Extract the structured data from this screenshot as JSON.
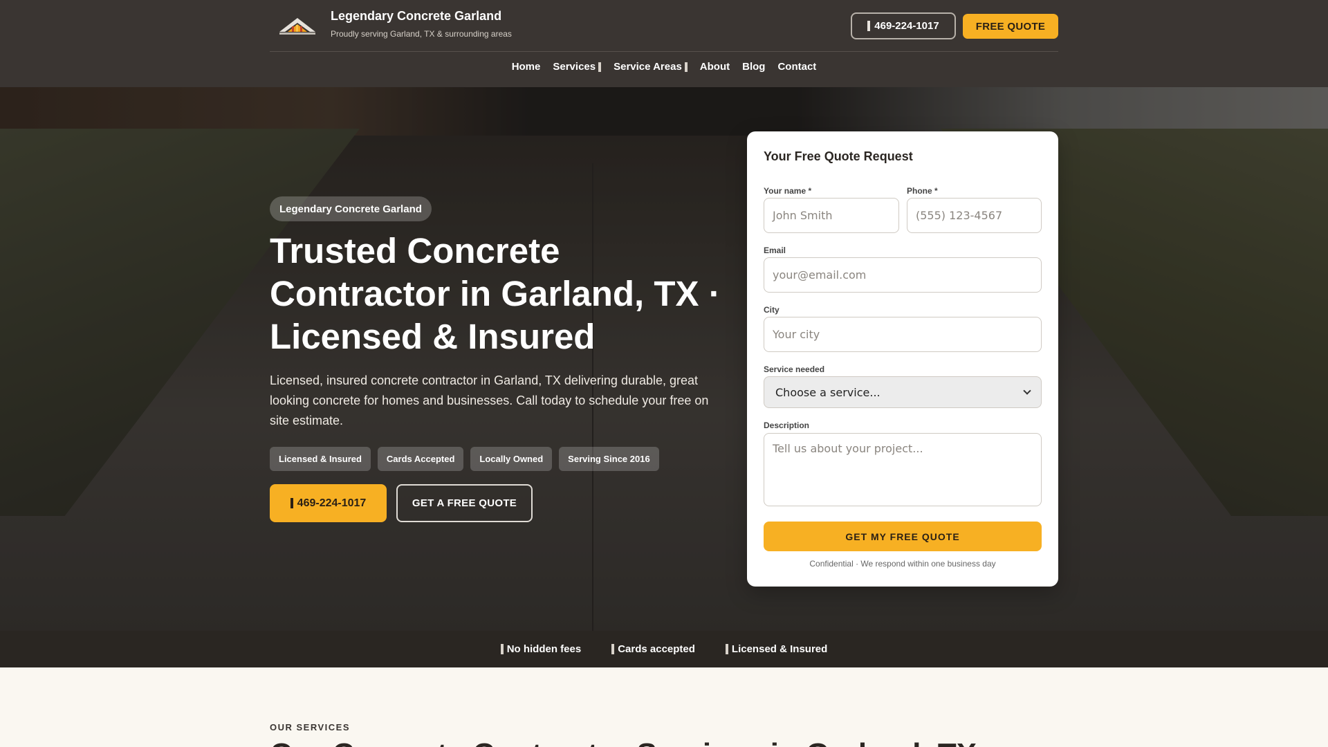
{
  "header": {
    "brand_title": "Legendary Concrete Garland",
    "brand_sub": "Proudly serving Garland, TX & surrounding areas",
    "phone": "469-224-1017",
    "quote_btn": "FREE QUOTE",
    "logo_icon": "house-roof-logo"
  },
  "nav": {
    "items": [
      {
        "label": "Home"
      },
      {
        "label": "Services"
      },
      {
        "label": "Service Areas"
      },
      {
        "label": "About"
      },
      {
        "label": "Blog"
      },
      {
        "label": "Contact"
      }
    ]
  },
  "hero": {
    "pill": "Legendary Concrete Garland",
    "title": "Trusted Concrete Contractor in Garland, TX · Licensed & Insured",
    "description": "Licensed, insured concrete contractor in Garland, TX delivering durable, great looking concrete for homes and businesses. Call today to schedule your free on site estimate.",
    "badges": [
      "Licensed & Insured",
      "Cards Accepted",
      "Locally Owned",
      "Serving Since 2016"
    ],
    "phone_btn": "469-224-1017",
    "quote_btn": "GET A FREE QUOTE"
  },
  "form": {
    "title": "Your Free Quote Request",
    "name_label": "Your name *",
    "name_placeholder": "John Smith",
    "phone_label": "Phone *",
    "phone_placeholder": "(555) 123-4567",
    "email_label": "Email",
    "email_placeholder": "your@email.com",
    "city_label": "City",
    "city_placeholder": "Your city",
    "service_label": "Service needed",
    "service_selected": "Choose a service...",
    "desc_label": "Description",
    "desc_placeholder": "Tell us about your project...",
    "submit": "GET MY FREE QUOTE",
    "note": "Confidential · We respond within one business day"
  },
  "strip": {
    "items": [
      "No hidden fees",
      "Cards accepted",
      "Licensed & Insured"
    ]
  },
  "services": {
    "eyebrow": "OUR SERVICES",
    "title": "Our Concrete Contractor Services in Garland, TX"
  },
  "colors": {
    "accent": "#f7b023",
    "header_bg": "#3a3532",
    "strip_bg": "#2a2622",
    "page_bg": "#faf7f1"
  }
}
